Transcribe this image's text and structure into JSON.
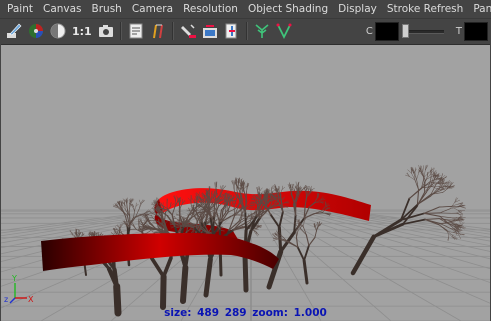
{
  "menu": [
    "Paint",
    "Canvas",
    "Brush",
    "Camera",
    "Resolution",
    "Object Shading",
    "Display",
    "Stroke Refresh",
    "Panels"
  ],
  "toolbar": {
    "ratio_label": "1:1",
    "color_label": "C",
    "transparency_label": "T",
    "color_value": "#000000",
    "transparency_value": "#000000"
  },
  "status": {
    "size_label": "size:",
    "size_value": "489",
    "overlap_value": "289",
    "zoom_label": "zoom:",
    "zoom_value": "1.000"
  },
  "axes": {
    "y": "Y",
    "z": "z",
    "x": "X"
  }
}
